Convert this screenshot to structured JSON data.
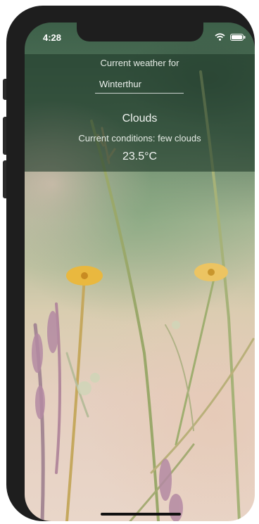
{
  "status_bar": {
    "time": "4:28",
    "icons": [
      "wifi-icon",
      "battery-icon"
    ]
  },
  "weather": {
    "title": "Current weather for",
    "city_input_value": "Winterthur",
    "condition": "Clouds",
    "conditions_text": "Current conditions: few clouds",
    "temperature": "23.5°C"
  },
  "colors": {
    "panel_overlay": "#203a2a",
    "text": "#f0f3f0",
    "phone_frame": "#1e1e1e"
  }
}
